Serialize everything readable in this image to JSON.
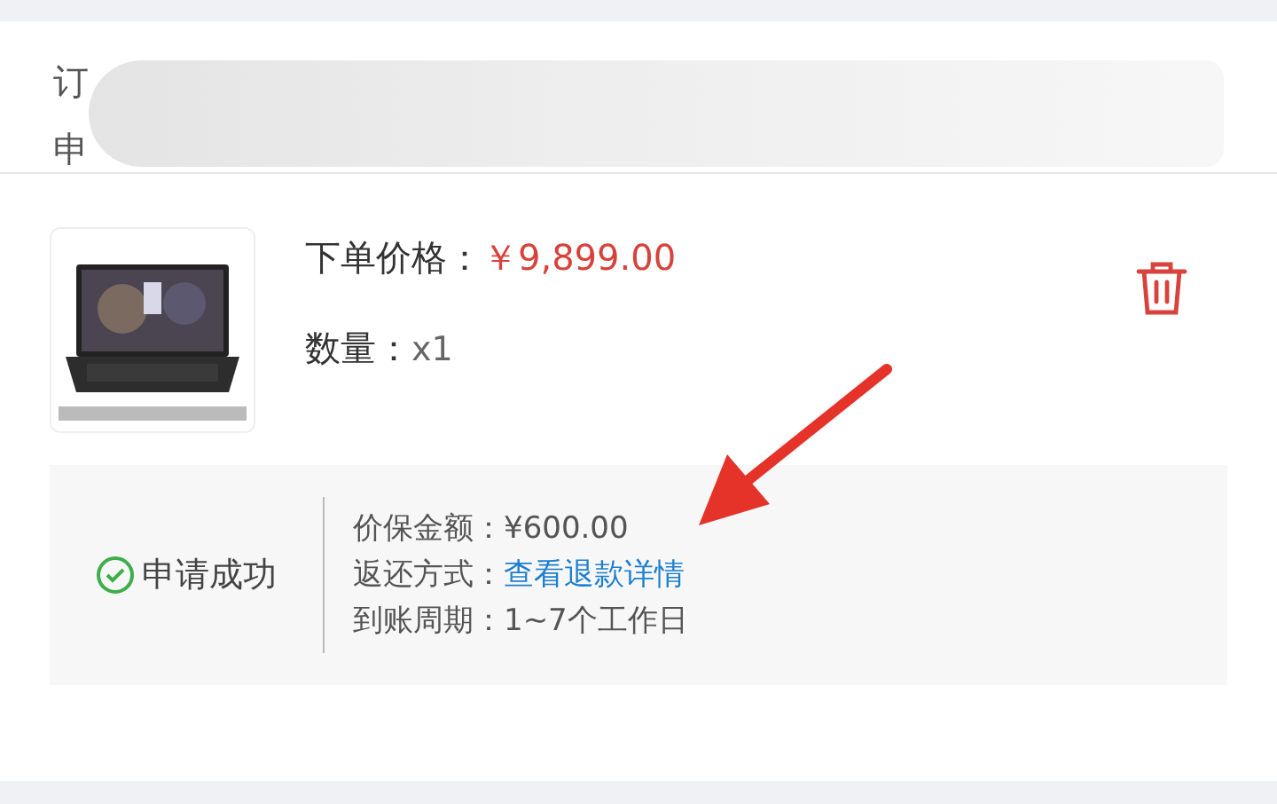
{
  "order_header": {
    "lines": [
      "订",
      "申"
    ],
    "redacted": true
  },
  "product": {
    "price_label": "下单价格：",
    "price": "￥9,899.00",
    "quantity_label": "数量：",
    "quantity": "x1"
  },
  "refund": {
    "status": "申请成功",
    "success": true,
    "rows": [
      {
        "label": "价保金额：",
        "value": "¥600.00",
        "kind": "text"
      },
      {
        "label": "返还方式：",
        "value": "查看退款详情",
        "kind": "link"
      },
      {
        "label": "到账周期：",
        "value": "1~7个工作日",
        "kind": "text"
      }
    ]
  },
  "annotation": {
    "kind": "arrow"
  }
}
